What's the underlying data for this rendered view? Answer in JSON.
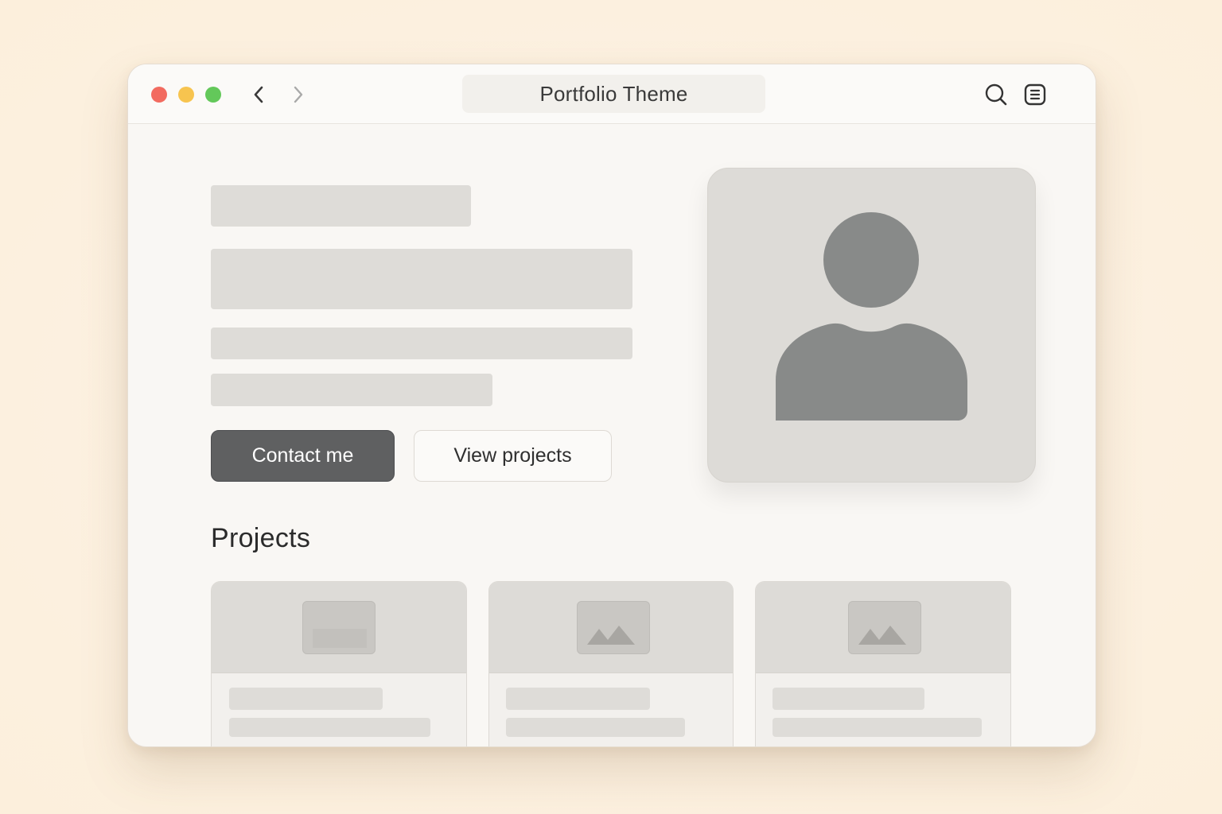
{
  "browser": {
    "title": "Portfolio Theme",
    "icons": {
      "back": "chevron-left-icon",
      "forward": "chevron-right-icon",
      "search": "search-icon",
      "reader": "reader-view-icon"
    }
  },
  "hero": {
    "contact_label": "Contact me",
    "view_projects_label": "View projects",
    "avatar_icon": "user-avatar-icon"
  },
  "projects": {
    "heading": "Projects",
    "cards": [
      {
        "thumb_icon": "image-placeholder-icon"
      },
      {
        "thumb_icon": "image-landscape-icon"
      },
      {
        "thumb_icon": "image-landscape-icon"
      }
    ]
  },
  "colors": {
    "background": "#fdf1e1",
    "window": "#f9f7f4",
    "skeleton": "#dedcd8",
    "primary_button": "#5f6061",
    "avatar_figure": "#888a89",
    "traffic_red": "#f26b60",
    "traffic_yellow": "#f7c44f",
    "traffic_green": "#63c85a"
  }
}
